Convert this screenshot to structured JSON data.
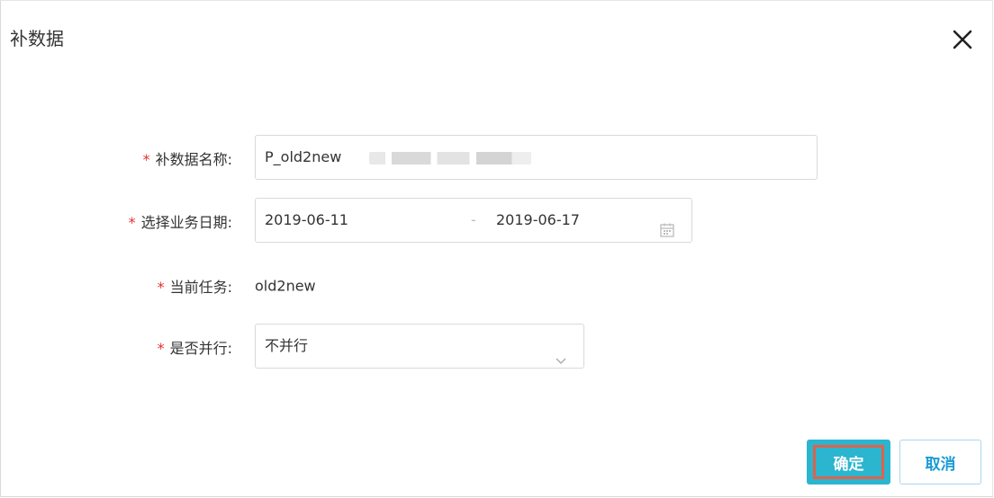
{
  "dialog": {
    "title": "补数据",
    "close_icon": "close-icon"
  },
  "form": {
    "required_mark": "*",
    "name": {
      "label": "补数据名称:",
      "value": "P_old2new"
    },
    "date_range": {
      "label": "选择业务日期:",
      "start": "2019-06-11",
      "separator": "-",
      "end": "2019-06-17",
      "icon": "calendar-icon"
    },
    "current_task": {
      "label": "当前任务:",
      "value": "old2new"
    },
    "parallel": {
      "label": "是否并行:",
      "value": "不并行",
      "icon": "chevron-down-icon"
    }
  },
  "footer": {
    "confirm_label": "确定",
    "cancel_label": "取消"
  },
  "colors": {
    "primary": "#2bb5cf",
    "required": "#e5302d",
    "highlight_border": "#e0624a",
    "cancel_text": "#1a9bd6"
  }
}
